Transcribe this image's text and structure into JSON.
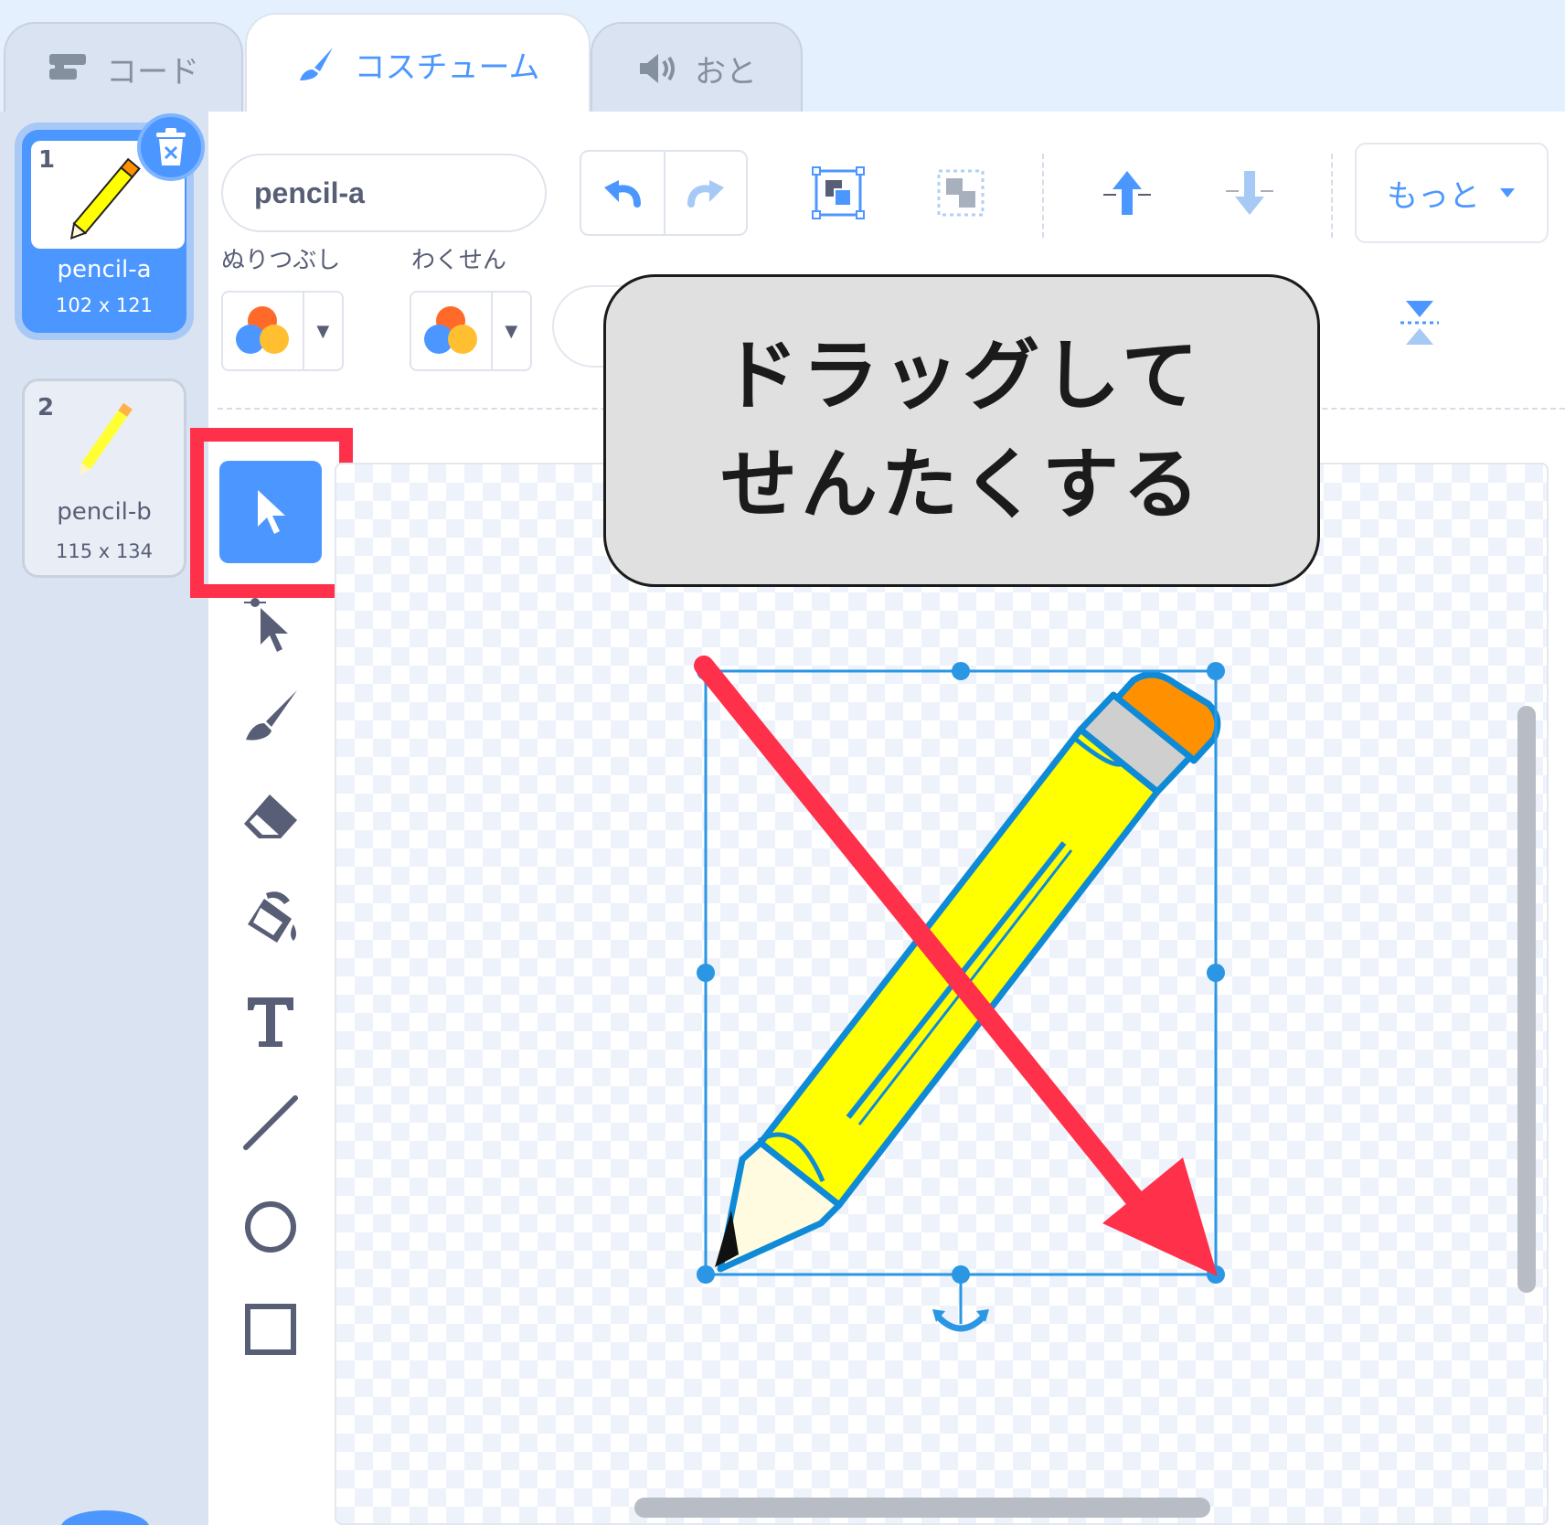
{
  "tabs": [
    {
      "label": "コード",
      "icon": "code-blocks-icon"
    },
    {
      "label": "コスチューム",
      "icon": "paintbrush-icon"
    },
    {
      "label": "おと",
      "icon": "speaker-icon"
    }
  ],
  "costumes": [
    {
      "number": "1",
      "name": "pencil-a",
      "size": "102 x 121"
    },
    {
      "number": "2",
      "name": "pencil-b",
      "size": "115 x 134"
    }
  ],
  "editor": {
    "costume_name": "pencil-a",
    "fill_label": "ぬりつぶし",
    "outline_label": "わくせん",
    "more_label": "もっと"
  },
  "tools": [
    "select-icon",
    "reshape-icon",
    "brush-icon",
    "eraser-icon",
    "fill-icon",
    "text-icon",
    "line-icon",
    "circle-icon",
    "rectangle-icon"
  ],
  "callout": {
    "line1": "ドラッグして",
    "line2": "せんたくする"
  },
  "colors": {
    "accent": "#4c97ff",
    "highlight": "#ff3049",
    "pencil_yellow": "#ffff00",
    "eraser_orange": "#ff9100"
  }
}
